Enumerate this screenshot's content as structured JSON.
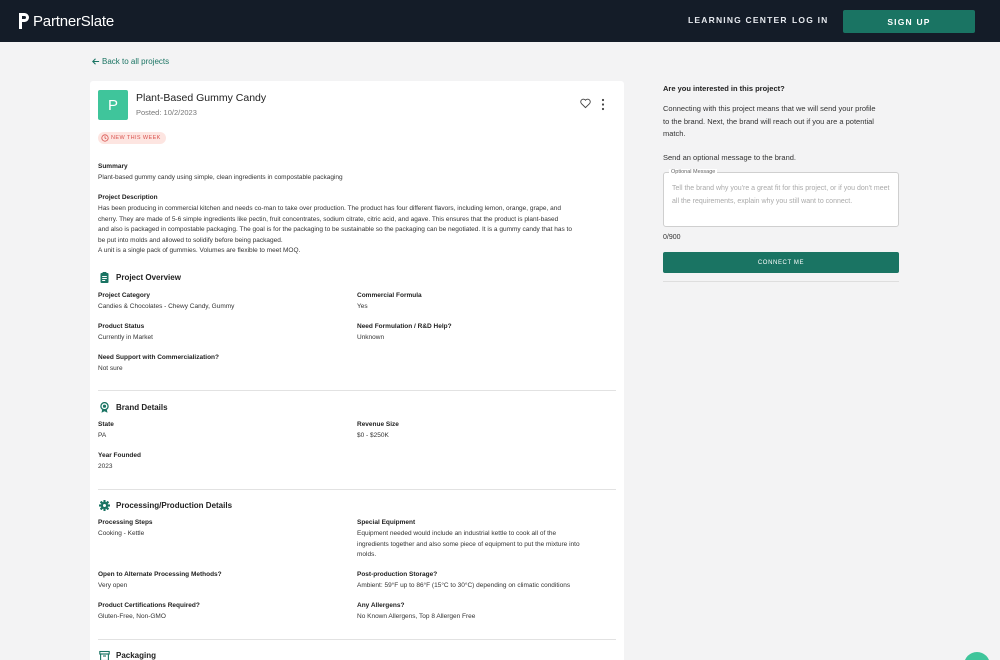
{
  "nav": {
    "logo": "PartnerSlate",
    "learning_center": "LEARNING CENTER",
    "log_in": "LOG IN",
    "sign_up": "SIGN UP"
  },
  "back_link": "Back to all projects",
  "project": {
    "avatar_letter": "P",
    "title": "Plant-Based Gummy Candy",
    "posted": "Posted: 10/2/2023",
    "badge": "NEW THIS WEEK",
    "summary_label": "Summary",
    "summary": "Plant-based gummy candy using simple, clean ingredients in compostable packaging",
    "description_label": "Project Description",
    "description_lines": [
      "Has been producing in commercial kitchen and needs co-man to take over production. The product has four different flavors, including lemon, orange, grape, and",
      "cherry. They are made of 5-6 simple ingredients like pectin, fruit concentrates, sodium citrate, citric acid, and agave. This ensures that the product is plant-based",
      "and also is packaged in compostable packaging. The goal is for the packaging to be sustainable so the packaging can be negotiated. It is a gummy candy that has to",
      "be put into molds and allowed to solidify before being packaged.",
      "A unit is a single pack of gummies. Volumes are flexible to meet MOQ."
    ]
  },
  "overview": {
    "title": "Project Overview",
    "category_label": "Project Category",
    "category": "Candies & Chocolates - Chewy Candy, Gummy",
    "formula_label": "Commercial Formula",
    "formula": "Yes",
    "status_label": "Product Status",
    "status": "Currently in Market",
    "rd_label": "Need Formulation / R&D Help?",
    "rd": "Unknown",
    "support_label": "Need Support with Commercialization?",
    "support": "Not sure"
  },
  "brand": {
    "title": "Brand Details",
    "state_label": "State",
    "state": "PA",
    "revenue_label": "Revenue Size",
    "revenue": "$0 - $250K",
    "founded_label": "Year Founded",
    "founded": "2023"
  },
  "processing": {
    "title": "Processing/Production Details",
    "steps_label": "Processing Steps",
    "steps": "Cooking - Kettle",
    "equipment_label": "Special Equipment",
    "equipment_lines": [
      "Equipment needed would include an industrial kettle to cook all of the",
      "ingredients together and also some piece of equipment to put the mixture into",
      "molds."
    ],
    "alternate_label": "Open to Alternate Processing Methods?",
    "alternate": "Very open",
    "storage_label": "Post-production Storage?",
    "storage": "Ambient: 59°F up to 86°F (15°C to 30°C) depending on climatic conditions",
    "certs_label": "Product Certifications Required?",
    "certs": "Gluten-Free, Non-GMO",
    "allergens_label": "Any Allergens?",
    "allergens": "No Known Allergens, Top 8 Allergen Free"
  },
  "packaging": {
    "title": "Packaging"
  },
  "sidebar": {
    "question": "Are you interested in this project?",
    "explain_lines": [
      "Connecting with this project means that we will send your profile",
      "to the brand. Next, the brand will reach out if you are a potential",
      "match."
    ],
    "send_label": "Send an optional message to the brand.",
    "message_legend": "Optional Message",
    "message_placeholder": "Tell the brand why you're a great fit for this project, or if you don't meet all the requirements, explain why you still want to connect.",
    "counter": "0/900",
    "connect": "CONNECT ME"
  },
  "colors": {
    "nav_bg": "#141c28",
    "accent": "#1a7463",
    "avatar": "#3fc59b",
    "badge_bg": "#fde5e1",
    "badge_text": "#d9534f"
  }
}
